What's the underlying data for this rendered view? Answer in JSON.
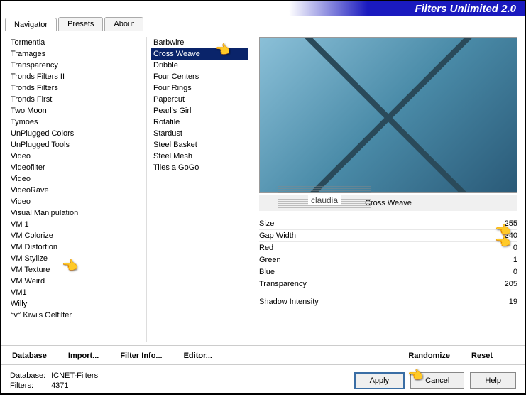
{
  "title": "Filters Unlimited 2.0",
  "tabs": [
    "Navigator",
    "Presets",
    "About"
  ],
  "active_tab": 0,
  "categories": [
    "Tormentia",
    "Tramages",
    "Transparency",
    "Tronds Filters II",
    "Tronds Filters",
    "Tronds First",
    "Two Moon",
    "Tymoes",
    "UnPlugged Colors",
    "UnPlugged Tools",
    "Video",
    "Videofilter",
    "Video",
    "VideoRave",
    "Video",
    "Visual Manipulation",
    "VM 1",
    "VM Colorize",
    "VM Distortion",
    "VM Stylize",
    "VM Texture",
    "VM Weird",
    "VM1",
    "Willy",
    "°v° Kiwi's Oelfilter"
  ],
  "selected_category_index": 20,
  "filters": [
    "Barbwire",
    "Cross Weave",
    "Dribble",
    "Four Centers",
    "Four Rings",
    "Papercut",
    "Pearl's Girl",
    "Rotatile",
    "Stardust",
    "Steel Basket",
    "Steel Mesh",
    "Tiles a GoGo"
  ],
  "selected_filter_index": 1,
  "current_filter_name": "Cross Weave",
  "sliders": [
    {
      "label": "Size",
      "value": 255,
      "pos": 100
    },
    {
      "label": "Gap Width",
      "value": 240,
      "pos": 94
    },
    {
      "label": "Red",
      "value": 0,
      "pos": 0
    },
    {
      "label": "Green",
      "value": 1,
      "pos": 0
    },
    {
      "label": "Blue",
      "value": 0,
      "pos": 0
    },
    {
      "label": "Transparency",
      "value": 205,
      "pos": 80
    }
  ],
  "slider_b": {
    "label": "Shadow Intensity",
    "value": 19,
    "pos": 7
  },
  "links": {
    "database": "Database",
    "import": "Import...",
    "filterinfo": "Filter Info...",
    "editor": "Editor...",
    "randomize": "Randomize",
    "reset": "Reset"
  },
  "db": {
    "label_db": "Database:",
    "db_name": "ICNET-Filters",
    "label_filters": "Filters:",
    "filter_count": "4371"
  },
  "buttons": {
    "apply": "Apply",
    "cancel": "Cancel",
    "help": "Help"
  },
  "watermark": "claudia"
}
